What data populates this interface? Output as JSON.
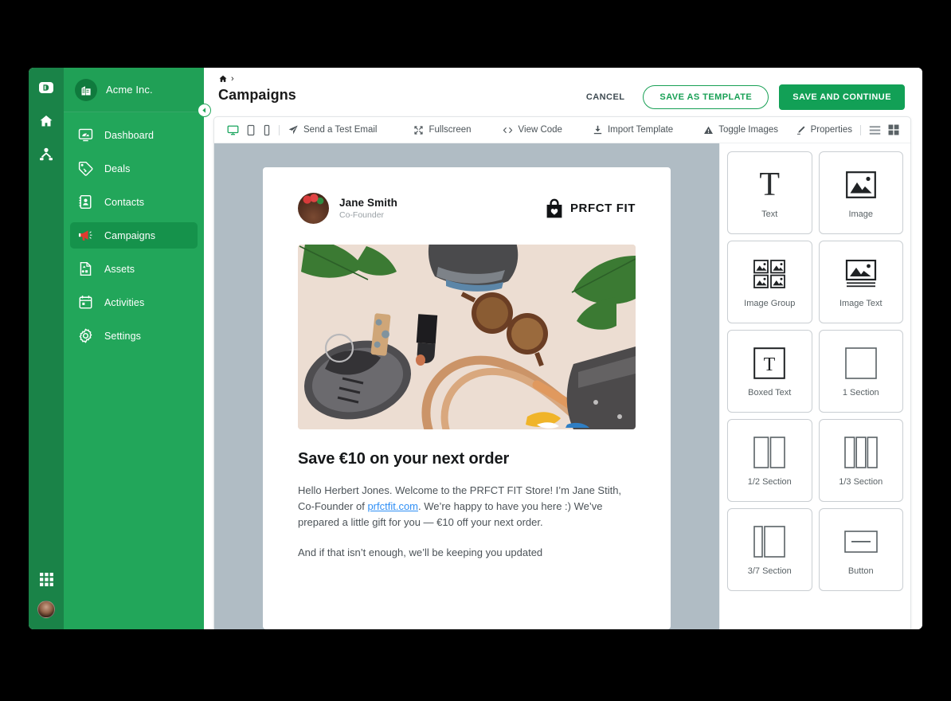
{
  "app": {
    "rail": {
      "items": [
        {
          "name": "logo-d",
          "icon": "logo-d-icon"
        },
        {
          "name": "home",
          "icon": "home-icon"
        },
        {
          "name": "org-chart",
          "icon": "org-chart-icon"
        }
      ],
      "bottom": [
        {
          "name": "apps-grid",
          "icon": "apps-grid-icon"
        },
        {
          "name": "user-avatar",
          "icon": "avatar-icon"
        }
      ]
    }
  },
  "sidebar": {
    "org_name": "Acme Inc.",
    "org_icon": "building-icon",
    "collapse_icon": "chevron-left-icon",
    "items": [
      {
        "label": "Dashboard",
        "icon": "dashboard-icon",
        "active": false
      },
      {
        "label": "Deals",
        "icon": "tag-icon",
        "active": false
      },
      {
        "label": "Contacts",
        "icon": "contacts-icon",
        "active": false
      },
      {
        "label": "Campaigns",
        "icon": "megaphone-icon",
        "active": true
      },
      {
        "label": "Assets",
        "icon": "document-icon",
        "active": false
      },
      {
        "label": "Activities",
        "icon": "calendar-icon",
        "active": false
      },
      {
        "label": "Settings",
        "icon": "gear-icon",
        "active": false
      }
    ]
  },
  "header": {
    "breadcrumb_home_icon": "home-icon",
    "breadcrumb_separator": "›",
    "title": "Campaigns",
    "cancel_label": "CANCEL",
    "save_template_label": "SAVE AS TEMPLATE",
    "save_continue_label": "SAVE AND CONTINUE"
  },
  "toolbar": {
    "devices": [
      {
        "name": "desktop",
        "icon": "monitor-icon",
        "active": true
      },
      {
        "name": "tablet",
        "icon": "tablet-icon",
        "active": false
      },
      {
        "name": "mobile",
        "icon": "mobile-icon",
        "active": false
      }
    ],
    "send_test_label": "Send a Test Email",
    "send_test_icon": "paper-plane-icon",
    "fullscreen_label": "Fullscreen",
    "fullscreen_icon": "expand-icon",
    "view_code_label": "View Code",
    "view_code_icon": "code-brackets-icon",
    "import_template_label": "Import Template",
    "import_template_icon": "download-icon",
    "toggle_images_label": "Toggle Images",
    "toggle_images_icon": "triangle-warning-icon",
    "properties_label": "Properties",
    "properties_icon": "pen-icon",
    "list_view_icon": "list-view-icon",
    "grid_view_icon": "grid-view-icon"
  },
  "email": {
    "sender_name": "Jane Smith",
    "sender_role": "Co-Founder",
    "sender_avatar_icon": "avatar-icon",
    "brand_name": "PRFCT FIT",
    "brand_icon": "shopping-bag-heart-icon",
    "hero_image_alt": "flat-lay of sneaker, sunglasses, bag and leaves",
    "heading": "Save €10 on your next order",
    "paragraph_1_before_link": "Hello Herbert Jones. Welcome to the PRFCT FIT Store! I’m Jane Stith, Co-Founder of ",
    "link_text": "prfctfit.com",
    "paragraph_1_after_link": ". We’re happy to have you here :) We’ve prepared  a little gift for you — €10 off your next order.",
    "paragraph_2": "And if that isn’t enough, we’ll be keeping you updated"
  },
  "palette": {
    "blocks": [
      {
        "label": "Text",
        "icon": "text-block-icon"
      },
      {
        "label": "Image",
        "icon": "image-block-icon"
      },
      {
        "label": "Image Group",
        "icon": "image-group-block-icon"
      },
      {
        "label": "Image Text",
        "icon": "image-text-block-icon"
      },
      {
        "label": "Boxed Text",
        "icon": "boxed-text-block-icon"
      },
      {
        "label": "1 Section",
        "icon": "one-section-block-icon"
      },
      {
        "label": "1/2 Section",
        "icon": "half-section-block-icon"
      },
      {
        "label": "1/3 Section",
        "icon": "third-section-block-icon"
      },
      {
        "label": "3/7 Section",
        "icon": "three-seventh-section-block-icon"
      },
      {
        "label": "Button",
        "icon": "button-block-icon"
      }
    ]
  },
  "colors": {
    "brand_green": "#22a65a",
    "rail_green": "#1a8348",
    "active_green": "#15924b",
    "save_green": "#12a056",
    "canvas_gray": "#b0bcc4",
    "link_blue": "#2f8ff5"
  }
}
